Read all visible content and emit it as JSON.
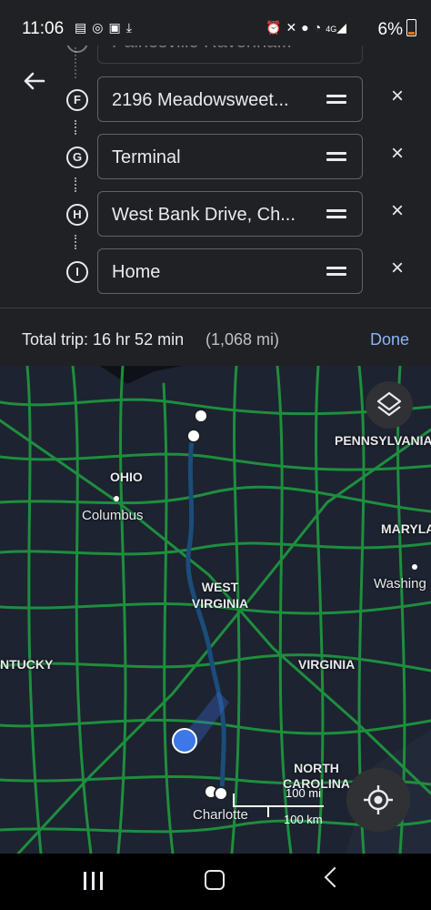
{
  "status_bar": {
    "time": "11:06",
    "battery_percent": "6%",
    "network_label": "4G",
    "left_icons": [
      "message-icon",
      "sync-icon",
      "image-icon",
      "download-icon"
    ],
    "right_icons": [
      "alarm-icon",
      "mute-icon",
      "location-icon",
      "wifi-icon",
      "signal-icon"
    ]
  },
  "directions": {
    "stops": [
      {
        "marker": "E",
        "label": "Painesville Ravenna..."
      },
      {
        "marker": "F",
        "label": "2196 Meadowsweet..."
      },
      {
        "marker": "G",
        "label": "Terminal"
      },
      {
        "marker": "H",
        "label": "West Bank Drive, Ch..."
      },
      {
        "marker": "I",
        "label": "Home"
      }
    ],
    "total_trip": "Total trip: 16 hr 52 min",
    "total_distance": "(1,068 mi)",
    "done_label": "Done"
  },
  "map": {
    "states": [
      "PENNSYLVANIA",
      "OHIO",
      "MARYLA",
      "WEST VIRGINIA",
      "NTUCKY",
      "VIRGINIA",
      "NORTH CAROLINA"
    ],
    "cities": [
      "Columbus",
      "Washing",
      "Charlotte"
    ],
    "scale": {
      "imperial": "100 mi",
      "metric": "100 km"
    },
    "colors": {
      "road": "#1e8e3e",
      "route": "#1a4d7a",
      "background": "#1d2330",
      "accent": "#8ab4f8"
    }
  }
}
